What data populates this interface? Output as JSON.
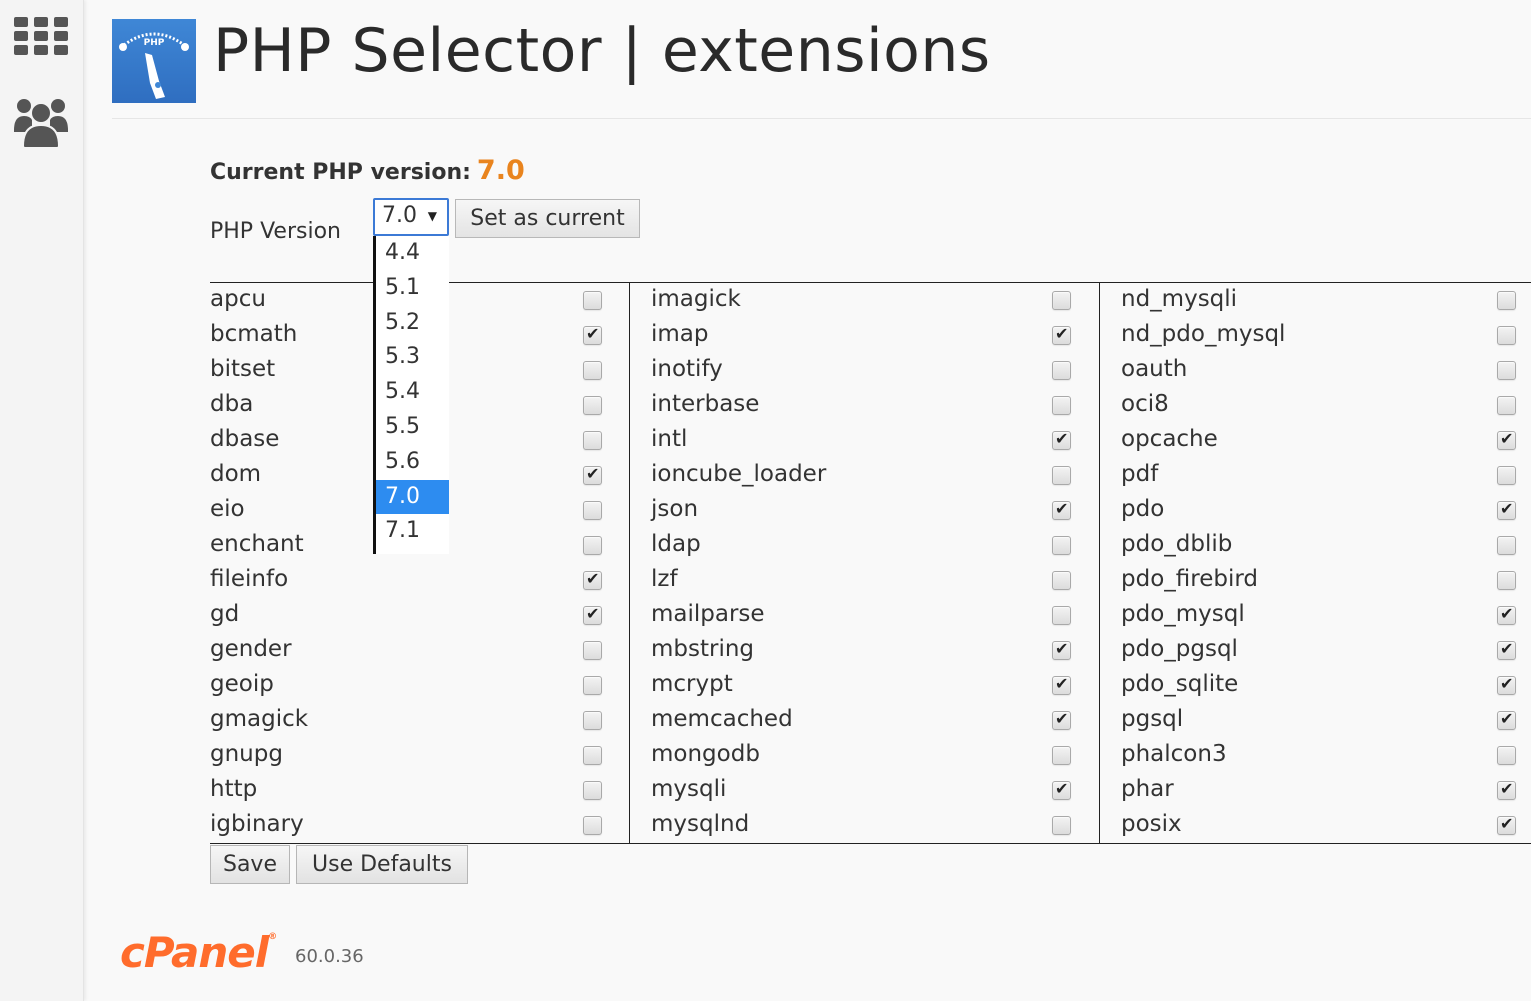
{
  "header": {
    "title": "PHP Selector | extensions",
    "logo_text": "PHP"
  },
  "sidebar": {
    "items": [
      {
        "icon": "apps-grid-icon"
      },
      {
        "icon": "users-icon"
      }
    ]
  },
  "current_version": {
    "label": "Current PHP version:",
    "value": "7.0"
  },
  "version_selector": {
    "label": "PHP Version",
    "selected": "7.0",
    "arrow": "▼",
    "options": [
      "4.4",
      "5.1",
      "5.2",
      "5.3",
      "5.4",
      "5.5",
      "5.6",
      "7.0",
      "7.1"
    ],
    "highlighted": "7.0",
    "set_current_label": "Set as current"
  },
  "extensions": {
    "columns": [
      [
        {
          "name": "apcu",
          "checked": false
        },
        {
          "name": "bcmath",
          "checked": true
        },
        {
          "name": "bitset",
          "checked": false
        },
        {
          "name": "dba",
          "checked": false
        },
        {
          "name": "dbase",
          "checked": false
        },
        {
          "name": "dom",
          "checked": true
        },
        {
          "name": "eio",
          "checked": false
        },
        {
          "name": "enchant",
          "checked": false
        },
        {
          "name": "fileinfo",
          "checked": true
        },
        {
          "name": "gd",
          "checked": true
        },
        {
          "name": "gender",
          "checked": false
        },
        {
          "name": "geoip",
          "checked": false
        },
        {
          "name": "gmagick",
          "checked": false
        },
        {
          "name": "gnupg",
          "checked": false
        },
        {
          "name": "http",
          "checked": false
        },
        {
          "name": "igbinary",
          "checked": false
        }
      ],
      [
        {
          "name": "imagick",
          "checked": false
        },
        {
          "name": "imap",
          "checked": true
        },
        {
          "name": "inotify",
          "checked": false
        },
        {
          "name": "interbase",
          "checked": false
        },
        {
          "name": "intl",
          "checked": true
        },
        {
          "name": "ioncube_loader",
          "checked": false
        },
        {
          "name": "json",
          "checked": true
        },
        {
          "name": "ldap",
          "checked": false
        },
        {
          "name": "lzf",
          "checked": false
        },
        {
          "name": "mailparse",
          "checked": false
        },
        {
          "name": "mbstring",
          "checked": true
        },
        {
          "name": "mcrypt",
          "checked": true
        },
        {
          "name": "memcached",
          "checked": true
        },
        {
          "name": "mongodb",
          "checked": false
        },
        {
          "name": "mysqli",
          "checked": true
        },
        {
          "name": "mysqlnd",
          "checked": false
        }
      ],
      [
        {
          "name": "nd_mysqli",
          "checked": false
        },
        {
          "name": "nd_pdo_mysql",
          "checked": false
        },
        {
          "name": "oauth",
          "checked": false
        },
        {
          "name": "oci8",
          "checked": false
        },
        {
          "name": "opcache",
          "checked": true
        },
        {
          "name": "pdf",
          "checked": false
        },
        {
          "name": "pdo",
          "checked": true
        },
        {
          "name": "pdo_dblib",
          "checked": false
        },
        {
          "name": "pdo_firebird",
          "checked": false
        },
        {
          "name": "pdo_mysql",
          "checked": true
        },
        {
          "name": "pdo_pgsql",
          "checked": true
        },
        {
          "name": "pdo_sqlite",
          "checked": true
        },
        {
          "name": "pgsql",
          "checked": true
        },
        {
          "name": "phalcon3",
          "checked": false
        },
        {
          "name": "phar",
          "checked": true
        },
        {
          "name": "posix",
          "checked": true
        }
      ]
    ]
  },
  "actions": {
    "save_label": "Save",
    "defaults_label": "Use Defaults"
  },
  "footer": {
    "brand": "cPanel",
    "registered": "®",
    "version": "60.0.36"
  },
  "colors": {
    "accent_orange": "#e9841e",
    "brand_orange": "#ff6c2c",
    "selection_blue": "#2d8cf0",
    "logo_blue": "#3f87d6"
  }
}
